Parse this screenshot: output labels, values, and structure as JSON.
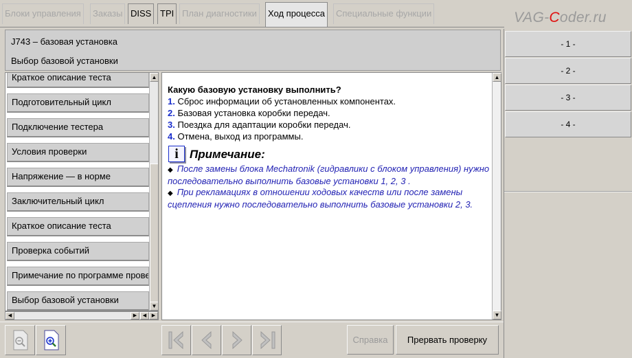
{
  "tabs": [
    {
      "label": "Блоки управления",
      "state": "disabled"
    },
    {
      "label": "Заказы",
      "state": "disabled"
    },
    {
      "label": "DISS",
      "state": "enabled"
    },
    {
      "label": "TPI",
      "state": "enabled"
    },
    {
      "label": "План диагностики",
      "state": "disabled"
    },
    {
      "label": "Ход процесса",
      "state": "active"
    },
    {
      "label": "Специальные функции",
      "state": "disabled"
    }
  ],
  "brand": {
    "prefix": "VAG-",
    "highlight": "C",
    "suffix": "oder.ru"
  },
  "header": {
    "line1": "J743 – базовая установка",
    "line2": "Выбор базовой установки"
  },
  "right_buttons": [
    "- 1 -",
    "- 2 -",
    "- 3 -",
    "- 4 -"
  ],
  "steps": [
    "Краткое описание теста",
    "Подготовительный цикл",
    "Подключение тестера",
    "Условия проверки",
    "Напряжение — в норме",
    "Заключительный цикл",
    "Краткое описание теста",
    "Проверка событий",
    "Примечание по программе проверки",
    "Выбор базовой установки"
  ],
  "content": {
    "question": "Какую базовую установку выполнить?",
    "options": [
      {
        "num": "1.",
        "text": " Сброс информации об установленных компонентах."
      },
      {
        "num": "2.",
        "text": " Базовая установка коробки передач."
      },
      {
        "num": "3.",
        "text": " Поездка для адаптации коробки передач."
      },
      {
        "num": "4.",
        "text": " Отмена, выход из программы."
      }
    ],
    "note_icon": "i",
    "note_title": "Примечание:",
    "notes": [
      "После замены блока Mechatronik (гидравлики с блоком управления) нужно последовательно выполнить базовые установки 1, 2, 3 .",
      "При рекламациях в отношении ходовых качеств или после замены сцепления нужно последовательно выполнить базовые установки 2, 3."
    ]
  },
  "toolbar": {
    "zoom_out_icon": "zoom-out-icon",
    "zoom_in_icon": "zoom-in-icon",
    "help_label": "Справка",
    "abort_label": "Прервать проверку"
  },
  "colors": {
    "option_number": "#1a2ecc",
    "note_text": "#2323b4",
    "brand_accent": "#e01010"
  }
}
